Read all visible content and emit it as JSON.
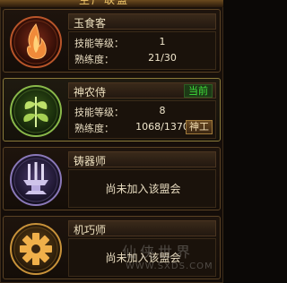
{
  "header": {
    "title": "生产联盟"
  },
  "cards": [
    {
      "name": "玉食客",
      "icon": "flame-icon",
      "skill_level_label": "技能等级：",
      "skill_level": "1",
      "proficiency_label": "熟练度：",
      "proficiency": "21/30"
    },
    {
      "name": "神农侍",
      "icon": "herb-icon",
      "status_badge": "当前",
      "skill_level_label": "技能等级：",
      "skill_level": "8",
      "proficiency_label": "熟练度：",
      "proficiency": "1068/1370",
      "action_button": "神工"
    },
    {
      "name": "铸器师",
      "icon": "anvil-icon",
      "not_joined": "尚未加入该盟会"
    },
    {
      "name": "机巧师",
      "icon": "gear-icon",
      "not_joined": "尚未加入该盟会"
    }
  ],
  "watermark": {
    "text": "仙侠世界",
    "url": "WWW.SXDS.COM"
  },
  "colors": {
    "active_badge": "#3fe03a",
    "border": "#5a4224",
    "text": "#e8dcc0"
  }
}
